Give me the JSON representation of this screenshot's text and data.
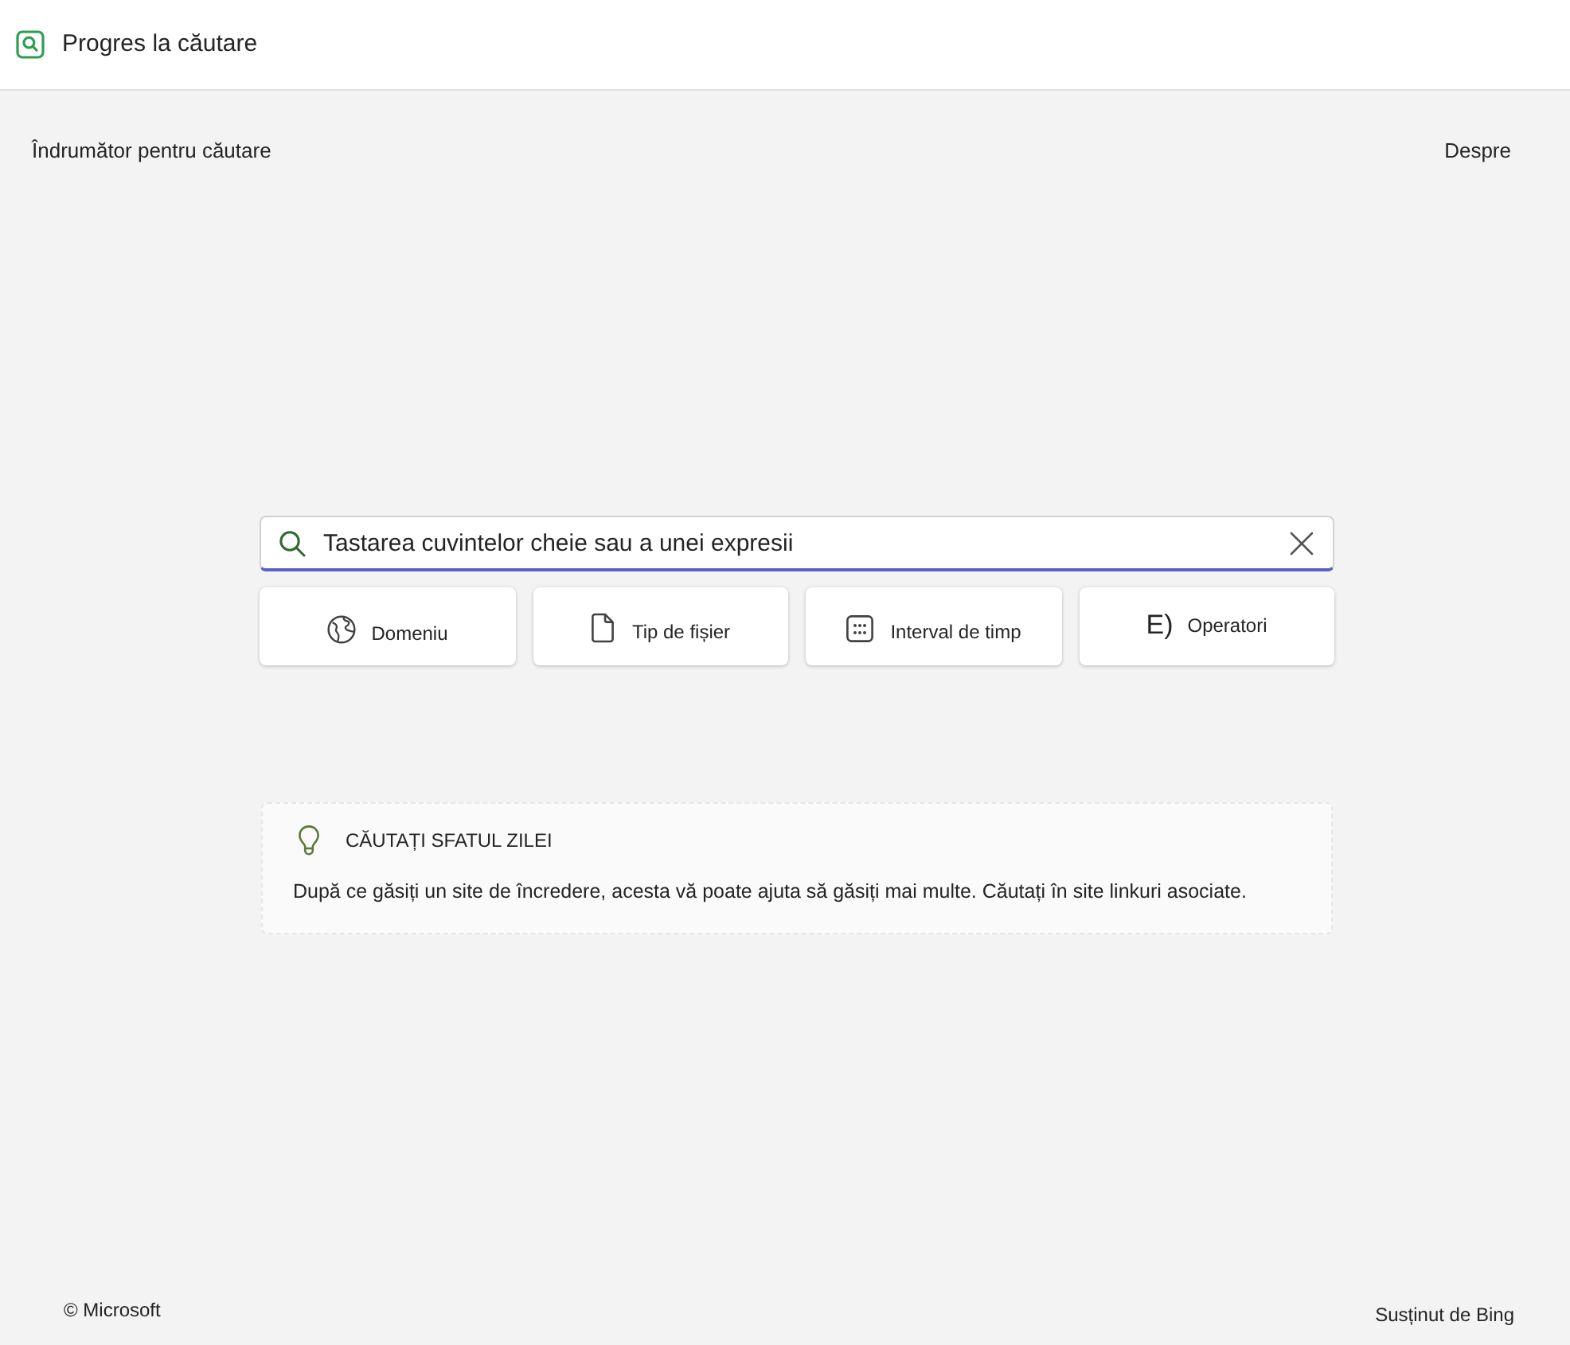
{
  "header": {
    "title": "Progres la căutare"
  },
  "nav": {
    "title": "Îndrumător pentru căutare",
    "about_link": "Despre"
  },
  "search": {
    "placeholder": "Tastarea cuvintelor cheie sau a unei expresii"
  },
  "filters": [
    {
      "kind": "globe",
      "label": "Domeniu"
    },
    {
      "kind": "file",
      "label": "Tip de fișier"
    },
    {
      "kind": "calendar",
      "label": "Interval de timp"
    },
    {
      "kind": "glyph",
      "glyph": "E)",
      "label": "Operatori"
    }
  ],
  "tip": {
    "heading": "CĂUTAȚI SFATUL ZILEI",
    "text": "După ce găsiți un site de încredere, acesta vă poate ajuta să găsiți mai multe. Căutați în site linkuri asociate."
  },
  "footer": {
    "copyright": "© Microsoft",
    "powered_by": "Susținut de Bing"
  }
}
